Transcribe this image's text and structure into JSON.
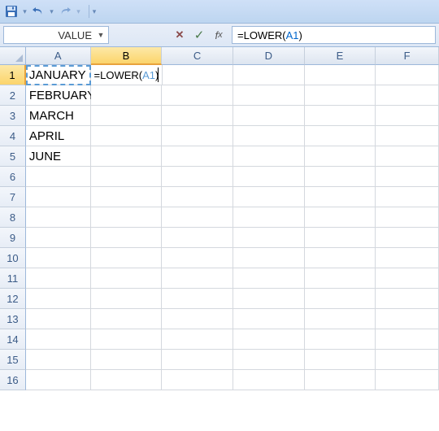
{
  "qat": {
    "save": "save-icon",
    "undo": "undo-icon",
    "redo": "redo-icon"
  },
  "namebox": {
    "value": "VALUE"
  },
  "formula_bar": {
    "formula_prefix": "=LOWER(",
    "formula_ref": "A1",
    "formula_suffix": ")"
  },
  "columns": [
    "A",
    "B",
    "C",
    "D",
    "E",
    "F"
  ],
  "rows": [
    "1",
    "2",
    "3",
    "4",
    "5",
    "6",
    "7",
    "8",
    "9",
    "10",
    "11",
    "12",
    "13",
    "14",
    "15",
    "16"
  ],
  "cells": {
    "A1": "JANUARY",
    "A2": "FEBRUARY",
    "A3": "MARCH",
    "A4": "APRIL",
    "A5": "JUNE"
  },
  "editing": {
    "cell": "B1",
    "display_prefix": "=LOWER(",
    "display_ref": "A1",
    "display_suffix": ")"
  },
  "active": {
    "row": "1",
    "col": "B",
    "ref_cell": "A1"
  }
}
